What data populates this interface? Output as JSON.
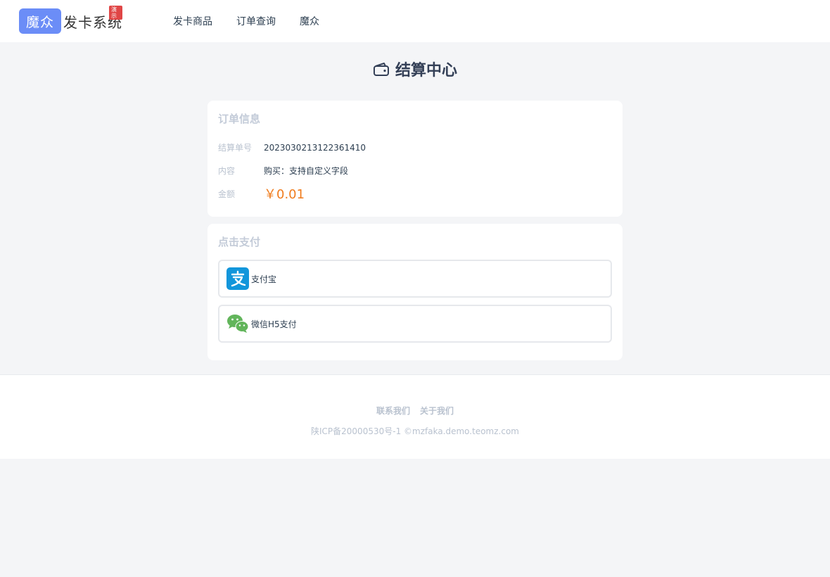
{
  "header": {
    "logo_box": "魔众",
    "logo_text": "发卡系统",
    "badge": "演示",
    "nav": [
      "发卡商品",
      "订单查询",
      "魔众"
    ]
  },
  "page": {
    "title": "结算中心",
    "title_icon": "wallet-icon"
  },
  "order_card": {
    "title": "订单信息",
    "rows": [
      {
        "label": "结算单号",
        "value": "2023030213122361410"
      },
      {
        "label": "内容",
        "value": "购买：支持自定义字段"
      },
      {
        "label": "金额",
        "value": "￥0.01"
      }
    ]
  },
  "pay_card": {
    "title": "点击支付",
    "methods": [
      {
        "label": "支付宝",
        "icon": "alipay-icon",
        "color": "#1296db"
      },
      {
        "label": "微信H5支付",
        "icon": "wechat-icon",
        "color": "#62b55b"
      }
    ]
  },
  "footer": {
    "links": [
      "联系我们",
      "关于我们"
    ],
    "copyright": "陕ICP备20000530号-1 ©mzfaka.demo.teomz.com"
  },
  "colors": {
    "accent": "#6b8df7",
    "amount": "#f07c1e",
    "background": "#f4f5f7"
  }
}
